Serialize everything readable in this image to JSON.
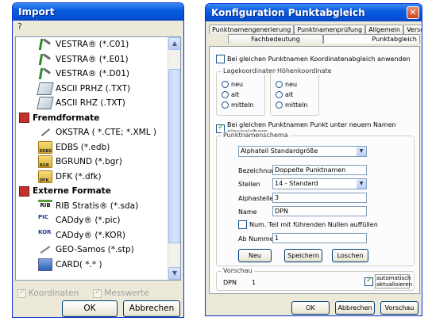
{
  "import_dialog": {
    "title": "Import",
    "help": "?",
    "items": [
      {
        "kind": "item",
        "icon": "vestra-icon",
        "label": "VESTRA® (*.C01)"
      },
      {
        "kind": "item",
        "icon": "vestra-icon",
        "label": "VESTRA® (*.E01)"
      },
      {
        "kind": "item",
        "icon": "vestra-icon",
        "label": "VESTRA® (*.D01)"
      },
      {
        "kind": "item",
        "icon": "ascii-icon",
        "label": "ASCII PRHZ (.TXT)"
      },
      {
        "kind": "item",
        "icon": "ascii-icon",
        "label": "ASCII RHZ (.TXT)"
      },
      {
        "kind": "group",
        "icon": "format-group-icon",
        "label": "Fremdformate"
      },
      {
        "kind": "item",
        "icon": "okstra-icon",
        "label": "OKSTRA ( *.CTE; *.XML )"
      },
      {
        "kind": "item",
        "icon": "folder-edbs-icon",
        "tag": "EDBS",
        "label": "EDBS (*.edb)"
      },
      {
        "kind": "item",
        "icon": "folder-bgr-icon",
        "tag": "BGR",
        "label": "BGRUND (*.bgr)"
      },
      {
        "kind": "item",
        "icon": "folder-dfk-icon",
        "tag": "DFK",
        "label": "DFK  (*.dfk)"
      },
      {
        "kind": "group",
        "icon": "format-group-icon",
        "label": "Externe Formate"
      },
      {
        "kind": "item",
        "icon": "rib-icon",
        "tag": "RIB",
        "label": "RIB Stratis® (*.sda)"
      },
      {
        "kind": "item",
        "icon": "cady-pic-icon",
        "tag": "PIC",
        "label": "CADdy® (*.pic)"
      },
      {
        "kind": "item",
        "icon": "cady-kor-icon",
        "tag": "KOR",
        "label": "CADdy® (*.KOR)"
      },
      {
        "kind": "item",
        "icon": "geo-icon",
        "label": "GEO-Samos (*.stp)"
      },
      {
        "kind": "item",
        "icon": "card-icon",
        "label": "CARD( *.* )"
      }
    ],
    "chk_koordinaten": "Koordinaten",
    "chk_messwerte": "Messwerte",
    "ok": "OK",
    "cancel": "Abbrechen"
  },
  "konf_dialog": {
    "title": "Konfiguration Punktabgleich",
    "tabs_row1": [
      "Punktnamengenerierung",
      "Punktnamenprüfung",
      "Allgemein",
      "Verschieben"
    ],
    "tabs_row2": [
      "Fachbedeutung",
      "Punktabgleich"
    ],
    "chk_koord": "Bei gleichen Punktnamen Koordinatenabgleich anwenden",
    "lage_title": "Lagekoordinaten",
    "hoehe_title": "Höhenkoordinate",
    "radio_neu": "neu",
    "radio_alt": "alt",
    "radio_mitteln": "mitteln",
    "chk_neu_name": "Bei gleichen Punktnamen Punkt unter neuem Namen einspeichern",
    "schema_title": "Punktnamenschema",
    "schema_value": "Alphateil Standardgröße",
    "bez_label": "Bezeichnung",
    "bez_value": "Doppelte Punktnamen",
    "stellen_label": "Stellen",
    "stellen_value": "14 - Standard",
    "alpha_label": "Alphastellen",
    "alpha_value": "3",
    "name_label": "Name",
    "name_value": "DPN",
    "chk_nullen": "Num. Teil mit führenden Nullen auffüllen",
    "ab_label": "Ab Nummer",
    "ab_value": "1",
    "btn_neu": "Neu",
    "btn_speichern": "Speichern",
    "btn_loeschen": "Loschen",
    "vorschau_title": "Vorschau",
    "vorschau_name": "DPN",
    "vorschau_num": "1",
    "chk_auto": "automatisch aktualisieren",
    "btn_ok": "OK",
    "btn_cancel": "Abbrechen",
    "btn_vorschau": "Vorschau"
  }
}
